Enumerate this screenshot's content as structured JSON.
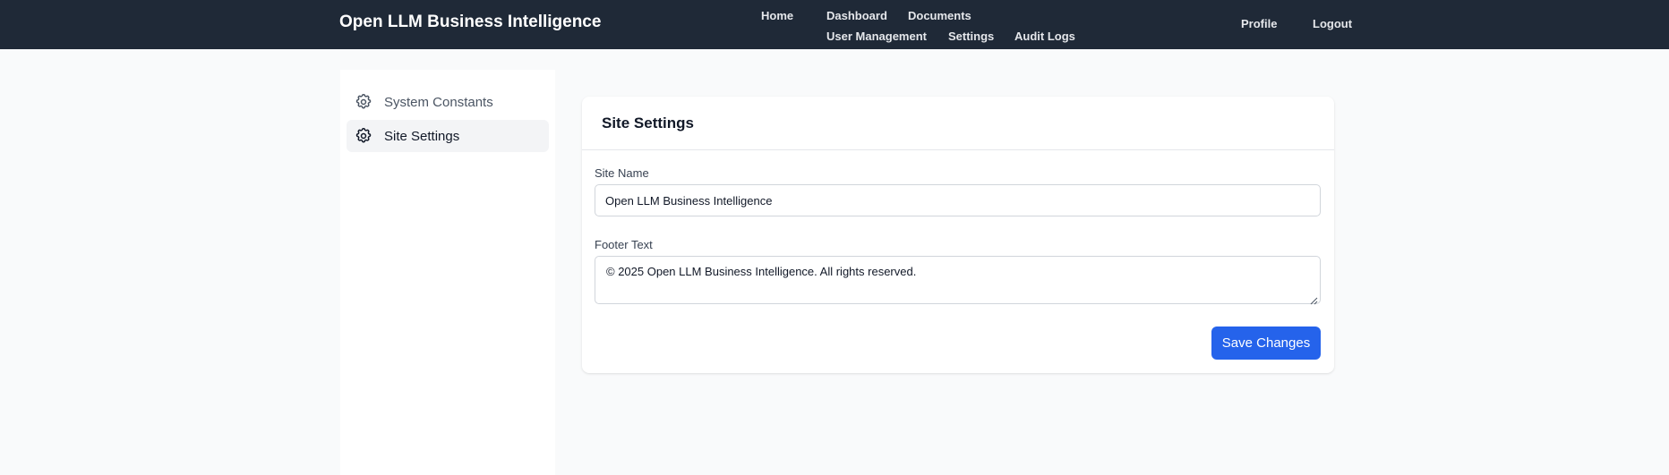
{
  "app": {
    "title": "Open LLM Business Intelligence"
  },
  "nav": {
    "home": "Home",
    "dashboard": "Dashboard",
    "documents": "Documents",
    "user_management": "User Management",
    "settings": "Settings",
    "audit_logs": "Audit Logs",
    "profile": "Profile",
    "logout": "Logout"
  },
  "sidebar": {
    "items": [
      {
        "label": "System Constants",
        "icon": "gear-icon",
        "active": false
      },
      {
        "label": "Site Settings",
        "icon": "gear-icon",
        "active": true
      }
    ]
  },
  "card": {
    "title": "Site Settings",
    "site_name": {
      "label": "Site Name",
      "value": "Open LLM Business Intelligence"
    },
    "footer_text": {
      "label": "Footer Text",
      "value": "© 2025 Open LLM Business Intelligence. All rights reserved."
    },
    "save_label": "Save Changes"
  },
  "colors": {
    "navbar_bg": "#1f2937",
    "page_bg": "#f9fafb",
    "primary_button": "#2563eb",
    "active_sidebar_bg": "#f3f4f6"
  }
}
